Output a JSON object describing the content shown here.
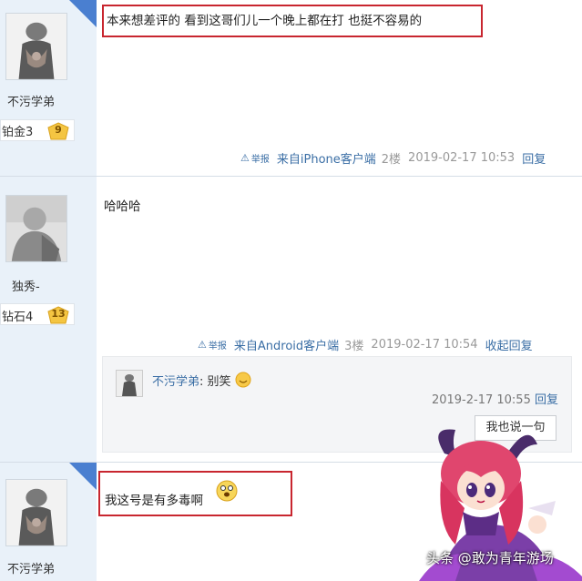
{
  "posts": [
    {
      "username": "不污学弟",
      "rank": "铂金3",
      "level": "9",
      "content": "本来想差评的 看到这哥们儿一个晚上都在打 也挺不容易的",
      "report_label": "举报",
      "source": "来自iPhone客户端",
      "floor": "2楼",
      "time": "2019-02-17 10:53",
      "reply_label": "回复"
    },
    {
      "username": "独秀-",
      "rank": "钻石4",
      "level": "13",
      "content": "哈哈哈",
      "report_label": "举报",
      "source": "来自Android客户端",
      "floor": "3楼",
      "time": "2019-02-17 10:54",
      "reply_label": "收起回复",
      "subreply": {
        "user": "不污学弟",
        "separator": ":",
        "content": "别笑",
        "time": "2019-2-17 10:55",
        "reply_label": "回复",
        "say_button": "我也说一句"
      }
    },
    {
      "username": "不污学弟",
      "content": "我这号是有多毒啊"
    }
  ],
  "watermark": "头条 @敢为青年游场",
  "colors": {
    "highlight": "#c8262f",
    "link": "#3a6ea5",
    "sidebar": "#e9f1f9"
  }
}
